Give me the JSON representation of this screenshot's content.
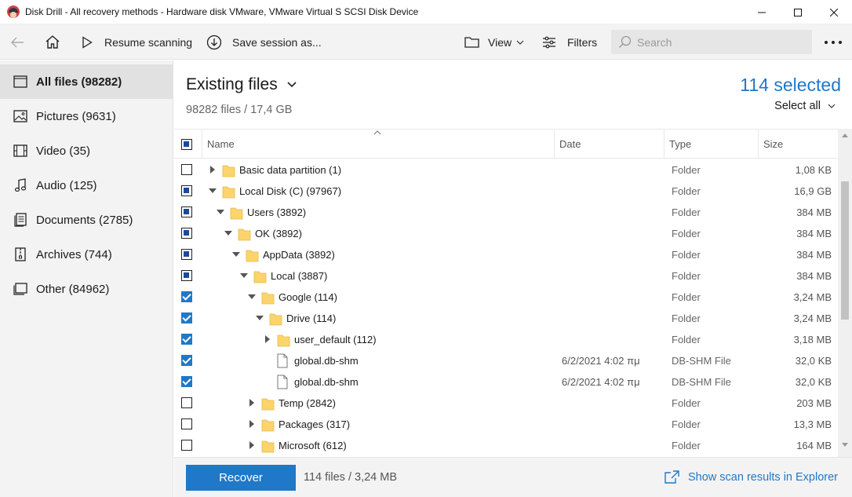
{
  "window": {
    "title": "Disk Drill - All recovery methods - Hardware disk VMware, VMware Virtual S SCSI Disk Device",
    "controls": [
      "minimize-icon",
      "maximize-icon",
      "close-icon"
    ]
  },
  "toolbar": {
    "back_icon": "arrow-left-icon",
    "home_icon": "home-icon",
    "resume_label": "Resume scanning",
    "save_label": "Save session as...",
    "view_label": "View",
    "filters_label": "Filters",
    "search_placeholder": "Search",
    "more_icon": "more-horizontal-icon"
  },
  "sidebar": {
    "items": [
      {
        "label": "All files (98282)",
        "icon": "all-files-icon",
        "active": true
      },
      {
        "label": "Pictures (9631)",
        "icon": "picture-icon",
        "active": false
      },
      {
        "label": "Video (35)",
        "icon": "video-icon",
        "active": false
      },
      {
        "label": "Audio (125)",
        "icon": "audio-icon",
        "active": false
      },
      {
        "label": "Documents (2785)",
        "icon": "document-icon",
        "active": false
      },
      {
        "label": "Archives (744)",
        "icon": "archive-icon",
        "active": false
      },
      {
        "label": "Other (84962)",
        "icon": "other-icon",
        "active": false
      }
    ]
  },
  "main": {
    "heading": "Existing files",
    "subheading": "98282 files / 17,4 GB",
    "selected_count": "114 selected",
    "select_all": "Select all"
  },
  "table": {
    "columns": {
      "name": "Name",
      "date": "Date",
      "type": "Type",
      "size": "Size"
    },
    "header_checkbox": "partial",
    "rows": [
      {
        "name": "Basic data partition (1)",
        "date": "",
        "type": "Folder",
        "size": "1,08 KB",
        "check": "none",
        "level": 0,
        "expander": "collapsed",
        "kind": "folder"
      },
      {
        "name": "Local Disk (C) (97967)",
        "date": "",
        "type": "Folder",
        "size": "16,9 GB",
        "check": "partial",
        "level": 0,
        "expander": "expanded",
        "kind": "folder"
      },
      {
        "name": "Users (3892)",
        "date": "",
        "type": "Folder",
        "size": "384 MB",
        "check": "partial",
        "level": 1,
        "expander": "expanded",
        "kind": "folder"
      },
      {
        "name": "OK (3892)",
        "date": "",
        "type": "Folder",
        "size": "384 MB",
        "check": "partial",
        "level": 2,
        "expander": "expanded",
        "kind": "folder"
      },
      {
        "name": "AppData (3892)",
        "date": "",
        "type": "Folder",
        "size": "384 MB",
        "check": "partial",
        "level": 3,
        "expander": "expanded",
        "kind": "folder"
      },
      {
        "name": "Local (3887)",
        "date": "",
        "type": "Folder",
        "size": "384 MB",
        "check": "partial",
        "level": 4,
        "expander": "expanded",
        "kind": "folder"
      },
      {
        "name": "Google (114)",
        "date": "",
        "type": "Folder",
        "size": "3,24 MB",
        "check": "checked",
        "level": 5,
        "expander": "expanded",
        "kind": "folder"
      },
      {
        "name": "Drive (114)",
        "date": "",
        "type": "Folder",
        "size": "3,24 MB",
        "check": "checked",
        "level": 6,
        "expander": "expanded",
        "kind": "folder"
      },
      {
        "name": "user_default (112)",
        "date": "",
        "type": "Folder",
        "size": "3,18 MB",
        "check": "checked",
        "level": 7,
        "expander": "collapsed",
        "kind": "folder"
      },
      {
        "name": "global.db-shm",
        "date": "6/2/2021 4:02 πμ",
        "type": "DB-SHM File",
        "size": "32,0 KB",
        "check": "checked",
        "level": 7,
        "expander": "none",
        "kind": "file"
      },
      {
        "name": "global.db-shm",
        "date": "6/2/2021 4:02 πμ",
        "type": "DB-SHM File",
        "size": "32,0 KB",
        "check": "checked",
        "level": 7,
        "expander": "none",
        "kind": "file"
      },
      {
        "name": "Temp (2842)",
        "date": "",
        "type": "Folder",
        "size": "203 MB",
        "check": "none",
        "level": 5,
        "expander": "collapsed",
        "kind": "folder"
      },
      {
        "name": "Packages (317)",
        "date": "",
        "type": "Folder",
        "size": "13,3 MB",
        "check": "none",
        "level": 5,
        "expander": "collapsed",
        "kind": "folder"
      },
      {
        "name": "Microsoft (612)",
        "date": "",
        "type": "Folder",
        "size": "164 MB",
        "check": "none",
        "level": 5,
        "expander": "collapsed",
        "kind": "folder"
      }
    ]
  },
  "footer": {
    "recover_label": "Recover",
    "summary": "114 files / 3,24 MB",
    "explorer_link": "Show scan results in Explorer"
  },
  "colors": {
    "accent": "#1f78c8",
    "folder": "#fbd56b",
    "sidebar_bg": "#f3f3f3",
    "sidebar_active": "#e1e1e1"
  }
}
